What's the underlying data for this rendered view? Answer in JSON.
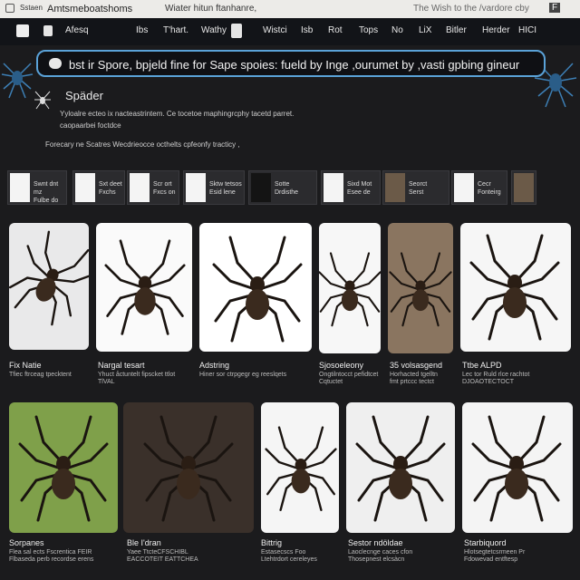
{
  "topbar": {
    "left_small": "Sstaen",
    "title": "Amtsmeboatshoms",
    "middle": "Wiater hitun ftanhanre,",
    "right": "The Wish to the /vardore cby",
    "flag_label": "F"
  },
  "nav": {
    "items": [
      "Afesq",
      "Ibs",
      "T'hart.",
      "Wathy",
      "Wistci",
      "Isb",
      "Rot",
      "Tops",
      "No",
      "LiX",
      "Bitler",
      "Herder",
      "HICI"
    ]
  },
  "search": {
    "value": "bst ir Spore, bpjeld fine for Sape spoies: fueld by Inge ,ourumet by ,vasti gpbing gineur"
  },
  "header": {
    "title": "Späder",
    "desc_line1": "Yyloalre ecteo ix nacteastrintem. Ce tocetoe maphingrcphy tacetd parret.",
    "desc_line2": "caopaarbei foctdce",
    "desc_line3": "Forecary ne Scatres   Wecdrieocce octhelts cpfeonfy tracticy ,"
  },
  "strip": [
    {
      "label": "Swnt dnt mz\nFulbe do",
      "thumb": "light"
    },
    {
      "label": "Sxt deet\nFxchs",
      "thumb": "light"
    },
    {
      "label": "Scr ort\nFxcs on",
      "thumb": "light"
    },
    {
      "label": "Sktw tetsos\nEsid lene",
      "thumb": "light"
    },
    {
      "label": "Sotte\nDrdisthe",
      "thumb": "dark"
    },
    {
      "label": "Sixd Mot\nEsee de",
      "thumb": "light"
    },
    {
      "label": "Seorct\nSerst",
      "thumb": "brown"
    },
    {
      "label": "Cecr\nFonteirg",
      "thumb": "light"
    },
    {
      "label": "",
      "thumb": "brown"
    }
  ],
  "gallery_row1": [
    {
      "caption": "Fix Natie",
      "sub": "Tfiec ftrceag tpecktent"
    },
    {
      "caption": "Nargal tesart",
      "sub": "Yhuct åctuntelt  fipscket ttlot\nTlVAL"
    },
    {
      "caption": "Adstring",
      "sub": "Hiner sor ctrpgegr eg reeslqets"
    },
    {
      "caption": "Sjosoeleony",
      "sub": "Ongtilntocct pefidtcet\nCqtuctet"
    },
    {
      "caption": "35 volsasgend",
      "sub": "Horhacted tgelltn\nfmt  prtccc tectct"
    },
    {
      "caption": "Ttbe ALPD",
      "sub": "Lec tor Ruld rlce rachtot\nDJOAOTECTOCT"
    }
  ],
  "gallery_row2": [
    {
      "caption": "Sorpanes",
      "sub": "Flea sal ects Fscrentica FEIR\nFlbaseda perb recordse erens"
    },
    {
      "caption": "Ble I'dran",
      "sub": "Yaee TtcteCFSCHIBL\nEACCOTEIT EATTCHEA"
    },
    {
      "caption": "Bittrig",
      "sub": "Estasecscs Foo\nLtehtrdort cereleyes"
    },
    {
      "caption": "Sestor ndöldae",
      "sub": "Laoclecnge caces cfon\nThosepnest elcsàcn"
    },
    {
      "caption": "Starbiquord",
      "sub": "Hlotsegtetcsrmeen Pr\nFdowevad entftesp"
    }
  ],
  "colors": {
    "accent": "#5aa2d8",
    "bg": "#1b1b1d"
  }
}
